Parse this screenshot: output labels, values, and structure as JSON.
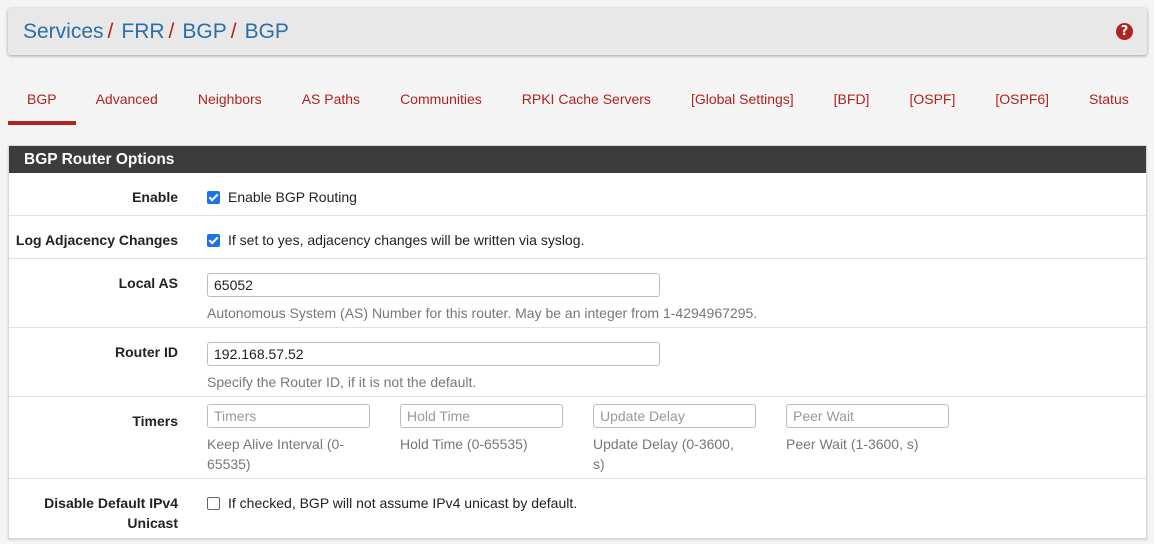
{
  "breadcrumb": [
    "Services",
    "FRR",
    "BGP",
    "BGP"
  ],
  "help_icon": "question-circle-icon",
  "tabs": [
    {
      "label": "BGP",
      "active": true
    },
    {
      "label": "Advanced"
    },
    {
      "label": "Neighbors"
    },
    {
      "label": "AS Paths"
    },
    {
      "label": "Communities"
    },
    {
      "label": "RPKI Cache Servers"
    },
    {
      "label": "[Global Settings]"
    },
    {
      "label": "[BFD]"
    },
    {
      "label": "[OSPF]"
    },
    {
      "label": "[OSPF6]"
    },
    {
      "label": "Status"
    }
  ],
  "panel": {
    "title": "BGP Router Options",
    "enable": {
      "label": "Enable",
      "checked": true,
      "text": "Enable BGP Routing"
    },
    "log_adjacency": {
      "label": "Log Adjacency Changes",
      "checked": true,
      "text": "If set to yes, adjacency changes will be written via syslog."
    },
    "local_as": {
      "label": "Local AS",
      "value": "65052",
      "help": "Autonomous System (AS) Number for this router. May be an integer from 1-4294967295."
    },
    "router_id": {
      "label": "Router ID",
      "value": "192.168.57.52",
      "help": "Specify the Router ID, if it is not the default."
    },
    "timers": {
      "label": "Timers",
      "fields": [
        {
          "placeholder": "Timers",
          "help": "Keep Alive Interval (0-65535)"
        },
        {
          "placeholder": "Hold Time",
          "help": "Hold Time (0-65535)"
        },
        {
          "placeholder": "Update Delay",
          "help": "Update Delay (0-3600, s)"
        },
        {
          "placeholder": "Peer Wait",
          "help": "Peer Wait (1-3600, s)"
        }
      ]
    },
    "disable_ipv4": {
      "label": "Disable Default IPv4 Unicast",
      "checked": false,
      "text": "If checked, BGP will not assume IPv4 unicast by default."
    }
  },
  "colors": {
    "accent": "#b0231e",
    "link": "#2c6ea8",
    "header_bg": "#3c3c3c",
    "checkbox": "#1a73e8"
  }
}
